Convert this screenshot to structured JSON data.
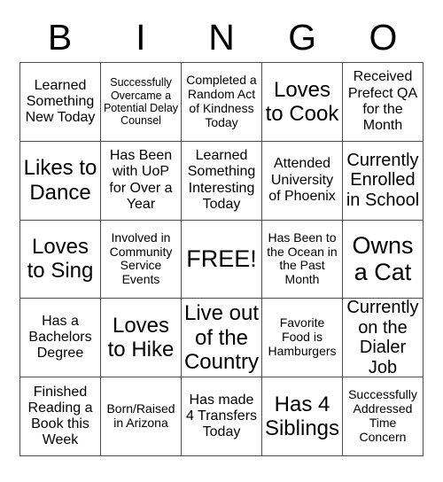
{
  "card": {
    "header_letters": [
      "B",
      "I",
      "N",
      "G",
      "O"
    ],
    "border_color": "#4d4d4d",
    "background_color": "#ffffff",
    "text_color": "#000000",
    "cells": [
      {
        "text": "Learned Something New Today",
        "size": "fs-md"
      },
      {
        "text": "Successfully Overcame a Potential Delay Counsel",
        "size": "fs-xs"
      },
      {
        "text": "Completed a Random Act of Kindness Today",
        "size": "fs-sm"
      },
      {
        "text": "Loves to Cook",
        "size": "fs-xl"
      },
      {
        "text": "Received Prefect QA for the Month",
        "size": "fs-md"
      },
      {
        "text": "Likes to Dance",
        "size": "fs-xl"
      },
      {
        "text": "Has Been with UoP for Over a Year",
        "size": "fs-md"
      },
      {
        "text": "Learned Something Interesting Today",
        "size": "fs-md"
      },
      {
        "text": "Attended University of Phoenix",
        "size": "fs-md"
      },
      {
        "text": "Currently Enrolled in School",
        "size": "fs-lg"
      },
      {
        "text": "Loves to Sing",
        "size": "fs-xl"
      },
      {
        "text": "Involved in Community Service Events",
        "size": "fs-sm"
      },
      {
        "text": "FREE!",
        "size": "fs-xxl"
      },
      {
        "text": "Has Been to the Ocean in the Past Month",
        "size": "fs-sm"
      },
      {
        "text": "Owns a Cat",
        "size": "fs-xxl"
      },
      {
        "text": "Has a Bachelors Degree",
        "size": "fs-md"
      },
      {
        "text": "Loves to Hike",
        "size": "fs-xl"
      },
      {
        "text": "Live out of the Country",
        "size": "fs-xl"
      },
      {
        "text": "Favorite Food is Hamburgers",
        "size": "fs-sm"
      },
      {
        "text": "Currently on the Dialer Job",
        "size": "fs-lg"
      },
      {
        "text": "Finished Reading a Book this Week",
        "size": "fs-md"
      },
      {
        "text": "Born/Raised in Arizona",
        "size": "fs-sm"
      },
      {
        "text": "Has made 4 Transfers Today",
        "size": "fs-md"
      },
      {
        "text": "Has 4 Siblings",
        "size": "fs-xl"
      },
      {
        "text": "Successfully Addressed Time Concern",
        "size": "fs-sm"
      }
    ]
  }
}
